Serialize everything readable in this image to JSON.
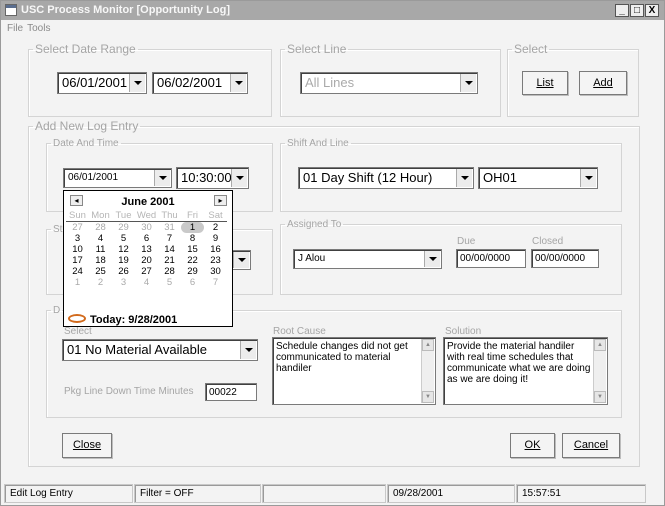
{
  "window": {
    "title": "USC Process Monitor [Opportunity Log]",
    "min": "_",
    "max": "□",
    "close": "X"
  },
  "menu": [
    "File",
    "Tools"
  ],
  "select_date_range": {
    "legend": "Select Date Range",
    "from": "06/01/2001",
    "to": "06/02/2001"
  },
  "select_line": {
    "legend": "Select Line",
    "value": "All Lines"
  },
  "select": {
    "legend": "Select",
    "list": "List",
    "add": "Add"
  },
  "new_entry": {
    "legend": "Add New Log Entry",
    "date_time": {
      "legend": "Date And Time",
      "date": "06/01/2001",
      "time": "10:30:00"
    },
    "shift_line": {
      "legend": "Shift And Line",
      "shift": "01 Day Shift (12 Hour)",
      "line": "OH01"
    },
    "status": {
      "legend_fragment": "St"
    },
    "assigned": {
      "legend": "Assigned To",
      "who": "J Alou",
      "due_label": "Due",
      "due": "00/00/0000",
      "closed_label": "Closed",
      "closed": "00/00/0000"
    },
    "details": {
      "legend_fragment": "D",
      "select_label": "Select",
      "select_value": "01 No Material Available",
      "pkg_label": "Pkg Line Down Time Minutes",
      "pkg_value": "00022",
      "root_label": "Root Cause",
      "root_text": "Schedule changes did not get communicated to material handiler",
      "solution_label": "Solution",
      "solution_text": "Provide the material handiler with real time schedules that communicate what we are doing as we are doing it!"
    }
  },
  "calendar": {
    "month": "June 2001",
    "prev": "◂",
    "next": "▸",
    "dow": [
      "Sun",
      "Mon",
      "Tue",
      "Wed",
      "Thu",
      "Fri",
      "Sat"
    ],
    "weeks": [
      [
        "27",
        "28",
        "29",
        "30",
        "31",
        "1",
        "2"
      ],
      [
        "3",
        "4",
        "5",
        "6",
        "7",
        "8",
        "9"
      ],
      [
        "10",
        "11",
        "12",
        "13",
        "14",
        "15",
        "16"
      ],
      [
        "17",
        "18",
        "19",
        "20",
        "21",
        "22",
        "23"
      ],
      [
        "24",
        "25",
        "26",
        "27",
        "28",
        "29",
        "30"
      ],
      [
        "1",
        "2",
        "3",
        "4",
        "5",
        "6",
        "7"
      ]
    ],
    "selected": "1",
    "today": "Today: 9/28/2001"
  },
  "buttons": {
    "close": "Close",
    "ok": "OK",
    "cancel": "Cancel"
  },
  "status": {
    "mode": "Edit Log Entry",
    "filter": "Filter = OFF",
    "blank": "",
    "date": "09/28/2001",
    "time": "15:57:51"
  }
}
